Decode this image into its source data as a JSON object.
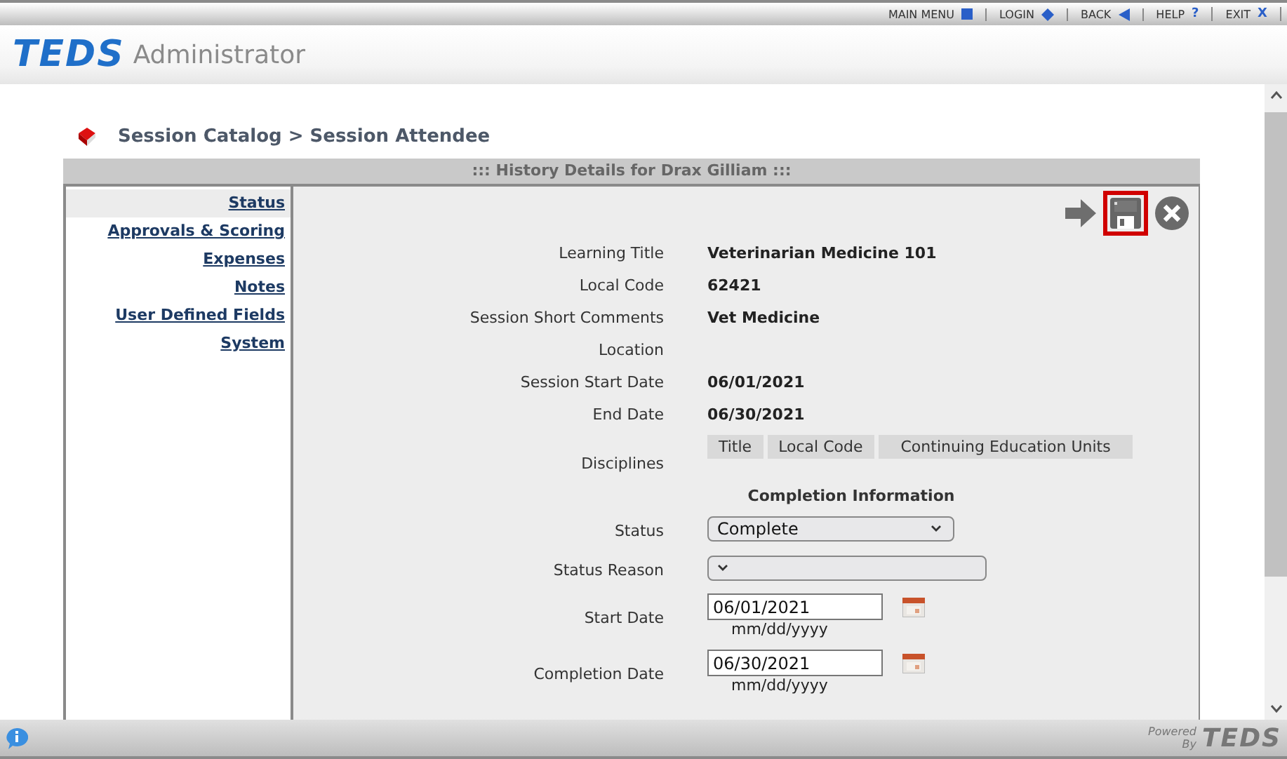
{
  "top_menu": [
    {
      "label": "MAIN MENU",
      "kind": "square"
    },
    {
      "label": "LOGIN",
      "kind": "diamond"
    },
    {
      "label": "BACK",
      "kind": "back"
    },
    {
      "label": "HELP",
      "kind": "help",
      "glyph": "?"
    },
    {
      "label": "EXIT",
      "kind": "exit",
      "glyph": "X"
    }
  ],
  "header": {
    "logo": "TEDS",
    "title": "Administrator"
  },
  "breadcrumb": "Session Catalog > Session Attendee",
  "panel_title": "::: History Details for Drax Gilliam :::",
  "nav": [
    {
      "label": "Status",
      "selected": true
    },
    {
      "label": "Approvals & Scoring",
      "selected": false
    },
    {
      "label": "Expenses",
      "selected": false
    },
    {
      "label": "Notes",
      "selected": false
    },
    {
      "label": "User Defined Fields",
      "selected": false
    },
    {
      "label": "System",
      "selected": false
    }
  ],
  "toolbar": [
    {
      "kind": "next",
      "highlighted": false
    },
    {
      "kind": "save",
      "highlighted": true
    },
    {
      "kind": "cancel",
      "highlighted": false
    }
  ],
  "fields": [
    {
      "kind": "text",
      "label": "Learning Title",
      "value": "Veterinarian Medicine 101"
    },
    {
      "kind": "text",
      "label": "Local Code",
      "value": "62421"
    },
    {
      "kind": "text",
      "label": "Session Short Comments",
      "value": "Vet Medicine"
    },
    {
      "kind": "text",
      "label": "Location"
    },
    {
      "kind": "text",
      "label": "Session Start Date",
      "value": "06/01/2021"
    },
    {
      "kind": "text",
      "label": "End Date",
      "value": "06/30/2021"
    },
    {
      "kind": "table",
      "label": "Disciplines",
      "columns": [
        "Title",
        "Local Code",
        "Continuing Education Units"
      ]
    },
    {
      "kind": "heading",
      "label": "Completion Information"
    },
    {
      "kind": "select",
      "label": "Status",
      "value": "Complete"
    },
    {
      "kind": "select",
      "label": "Status Reason"
    },
    {
      "kind": "date",
      "label": "Start Date",
      "value": "06/01/2021",
      "hint": "mm/dd/yyyy"
    },
    {
      "kind": "date",
      "label": "Completion Date",
      "value": "06/30/2021",
      "hint": "mm/dd/yyyy"
    }
  ],
  "footer": {
    "powered": "Powered",
    "by": "By",
    "logo": "TEDS"
  }
}
